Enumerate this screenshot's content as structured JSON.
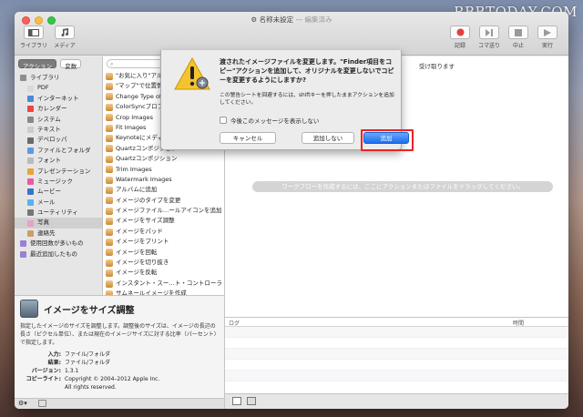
{
  "watermark": "RBBTODAY.COM",
  "window": {
    "title": "名称未設定",
    "title_status": "— 編集済み"
  },
  "toolbar": {
    "library_label": "ライブラリ",
    "media_label": "メディア",
    "record_label": "記録",
    "step_label": "コマ送り",
    "stop_label": "中止",
    "run_label": "実行"
  },
  "tabs": {
    "actions": "アクション",
    "variables": "変数"
  },
  "library": [
    {
      "label": "ライブラリ",
      "color": "#8e8e8e"
    },
    {
      "label": "PDF",
      "color": "#d9d9d9"
    },
    {
      "label": "インターネット",
      "color": "#4a8ad8"
    },
    {
      "label": "カレンダー",
      "color": "#e44"
    },
    {
      "label": "システム",
      "color": "#888"
    },
    {
      "label": "テキスト",
      "color": "#ccc"
    },
    {
      "label": "デベロッパ",
      "color": "#6a6a6a"
    },
    {
      "label": "ファイルとフォルダ",
      "color": "#5d9be0"
    },
    {
      "label": "フォント",
      "color": "#bbb"
    },
    {
      "label": "プレゼンテーション",
      "color": "#e8a33a"
    },
    {
      "label": "ミュージック",
      "color": "#ea5aa0"
    },
    {
      "label": "ムービー",
      "color": "#3a74c9"
    },
    {
      "label": "メール",
      "color": "#5ab0f0"
    },
    {
      "label": "ユーティリティ",
      "color": "#777"
    },
    {
      "label": "写真",
      "color": "#e5a0cc"
    },
    {
      "label": "連絡先",
      "color": "#c9a069"
    },
    {
      "label": "使用回数が多いもの",
      "color": "#9b7fd4"
    },
    {
      "label": "最近追加したもの",
      "color": "#9b7fd4"
    }
  ],
  "actions": [
    "\"お気に入り\"アルバム",
    "\"マップ\"で位置情報",
    "Change Type of Images",
    "ColorSyncプロファイル",
    "Crop Images",
    "Fit Images",
    "Keynoteにメディア",
    "Quartzコンポジション",
    "Quartzコンポジション",
    "Trim Images",
    "Watermark Images",
    "アルバムに追加",
    "イメージのタイプを変更",
    "イメージファイル…ールアイコンを追加",
    "イメージをサイズ調整",
    "イメージをパッド",
    "イメージをプリント",
    "イメージを回転",
    "イメージを切り抜き",
    "イメージを反転",
    "インスタント・スー…ト・コントローラ",
    "サムネールイメージを作成"
  ],
  "description": {
    "title": "イメージをサイズ調整",
    "text": "指定したイメージのサイズを調整します。調整後のサイズは、イメージの長辺の長さ（ピクセル単位）、または現在のイメージサイズに対する比率（パーセント）で指定します。",
    "input_k": "入力:",
    "input_v": "ファイル/フォルダ",
    "result_k": "結果:",
    "result_v": "ファイル/フォルダ",
    "version_k": "バージョン:",
    "version_v": "1.3.1",
    "copyright_k": "コピーライト:",
    "copyright_v": "Copyright © 2004–2012 Apple Inc.  All rights reserved."
  },
  "workflow": {
    "info": "受け取ります",
    "hint": "ワークフローを作成するには、ここにアクションまたはファイルをドラッグしてください。"
  },
  "log": {
    "col_log": "ログ",
    "col_time": "時間"
  },
  "dialog": {
    "message": "渡されたイメージファイルを変更します。\"Finder項目をコピー\"アクションを追加して、オリジナルを変更しないでコピーを変更するようにしますか?",
    "info": "この警告シートを回避するには、shiftキーを押したままアクションを追加してください。",
    "checkbox": "今後このメッセージを表示しない",
    "cancel": "キャンセル",
    "dont_add": "追加しない",
    "add": "追加"
  }
}
